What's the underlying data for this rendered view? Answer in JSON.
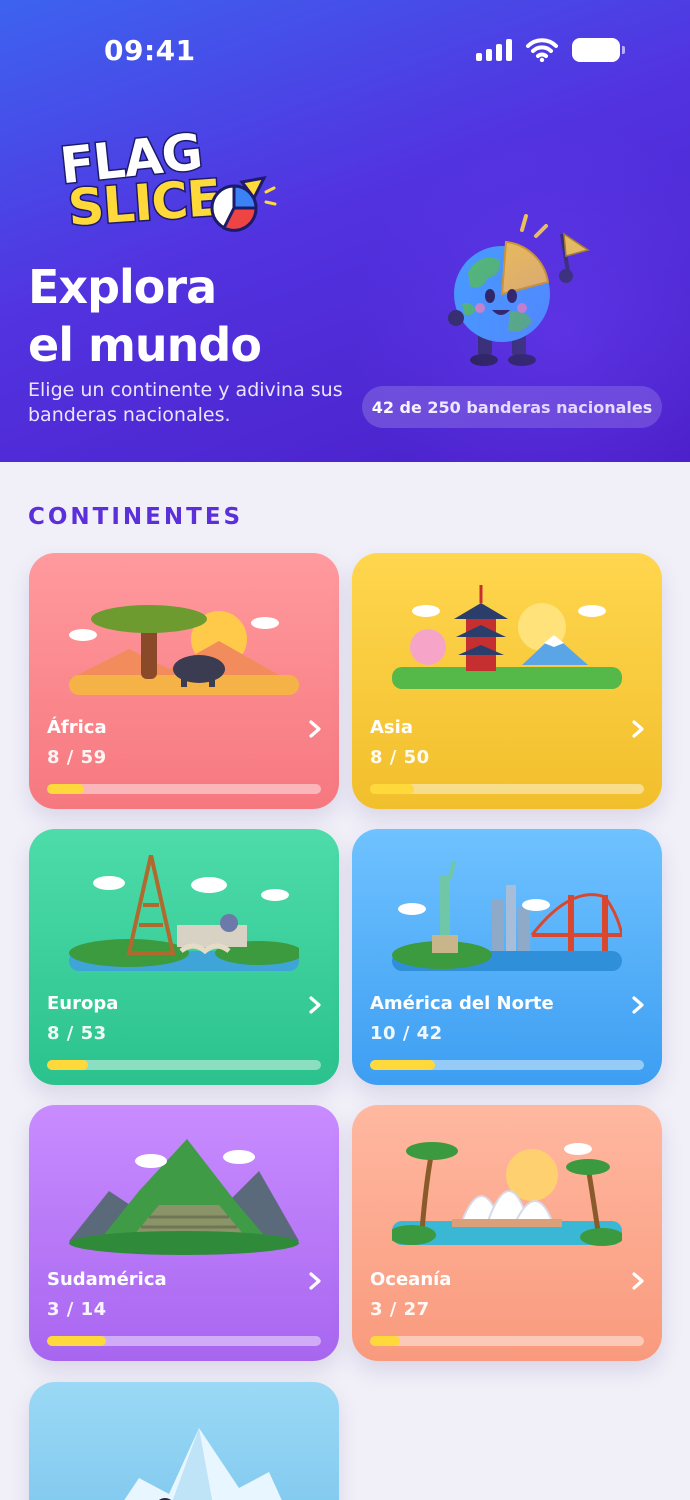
{
  "status_bar": {
    "time": "09:41"
  },
  "header": {
    "logo_line1": "FLAG",
    "logo_line2": "SLICE",
    "title_line1": "Explora",
    "title_line2": "el mundo",
    "subtitle": "Elige un continente y adivina sus banderas nacionales.",
    "progress_label": "42 de 250 banderas nacionales",
    "progress": {
      "found": 42,
      "total": 250
    }
  },
  "section_title": "CONTINENTES",
  "continents": [
    {
      "name": "África",
      "count": "8 / 59",
      "progress": 0.136
    },
    {
      "name": "Asia",
      "count": "8 / 50",
      "progress": 0.16
    },
    {
      "name": "Europa",
      "count": "8 / 53",
      "progress": 0.151
    },
    {
      "name": "América del Norte",
      "count": "10 / 42",
      "progress": 0.238
    },
    {
      "name": "Sudamérica",
      "count": "3 / 14",
      "progress": 0.214
    },
    {
      "name": "Oceanía",
      "count": "3 / 27",
      "progress": 0.111
    }
  ],
  "colors": {
    "accent": "#5b2fd9",
    "progress_fill": "#ffd93b",
    "africa": "#f6787f",
    "asia": "#f2bf2c",
    "europa": "#2bc28d",
    "america_norte": "#3d9ef2",
    "sudamerica": "#a866f0",
    "oceania": "#f99a7d",
    "antartida": "#7cc6ee"
  },
  "icons": {
    "status": [
      "signal-icon",
      "wifi-icon",
      "battery-icon"
    ],
    "card": "chevron-right-icon"
  }
}
